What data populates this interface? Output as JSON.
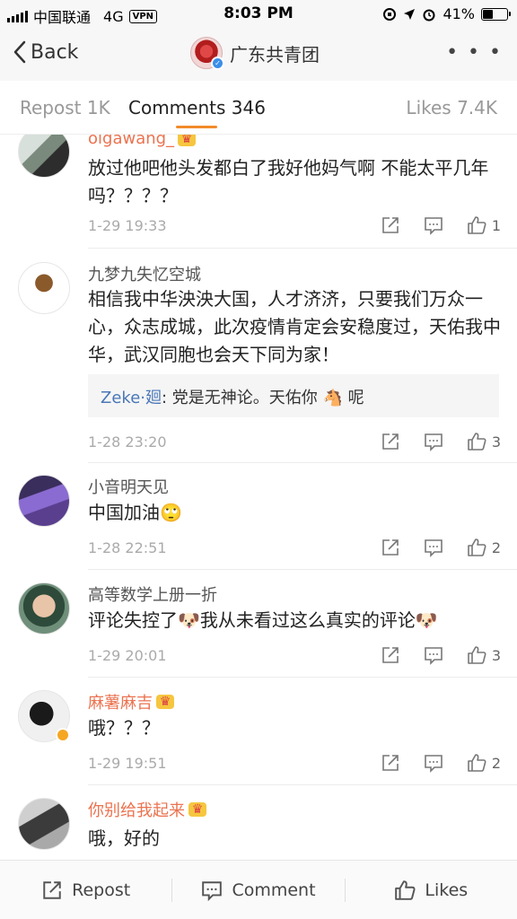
{
  "status_bar": {
    "carrier": "中国联通",
    "network": "4G",
    "vpn": "VPN",
    "time": "8:03 PM",
    "battery": "41%",
    "battery_level": 0.41
  },
  "nav": {
    "back_label": "Back",
    "title": "广东共青团",
    "more": "• • •"
  },
  "tabs": {
    "repost": "Repost 1K",
    "comments": "Comments 346",
    "likes": "Likes 7.4K",
    "active": "comments"
  },
  "comments": [
    {
      "user": "olgawang_",
      "text": "放过他吧他头发都白了我好他妈气啊 不能太平几年吗？？？？",
      "time": "1-29 19:33",
      "likes": "1"
    },
    {
      "user": "九梦九失忆空城",
      "text": "相信我中华泱泱大国，人才济济，只要我们万众一心，众志成城，此次疫情肯定会安稳度过，天佑我中华，武汉同胞也会天下同为家！",
      "reply_user": "Zeke·廻",
      "reply_text": ": 党是无神论。天佑你 🐴 呢",
      "time": "1-28 23:20",
      "likes": "3"
    },
    {
      "user": "小音明天见",
      "text": "中国加油🙄",
      "time": "1-28 22:51",
      "likes": "2"
    },
    {
      "user": "高等数学上册一折",
      "text": "评论失控了🐶我从未看过这么真实的评论🐶",
      "time": "1-29 20:01",
      "likes": "3"
    },
    {
      "user": "麻薯麻吉",
      "text": "哦？？？",
      "time": "1-29 19:51",
      "likes": "2"
    },
    {
      "user": "你别给我起来",
      "text": "哦，好的",
      "time": "",
      "likes": ""
    }
  ],
  "bottom_bar": {
    "repost": "Repost",
    "comment": "Comment",
    "likes": "Likes"
  },
  "colors": {
    "accent": "#f28b2a",
    "vip_name": "#eb7350",
    "link": "#4a77b7"
  }
}
